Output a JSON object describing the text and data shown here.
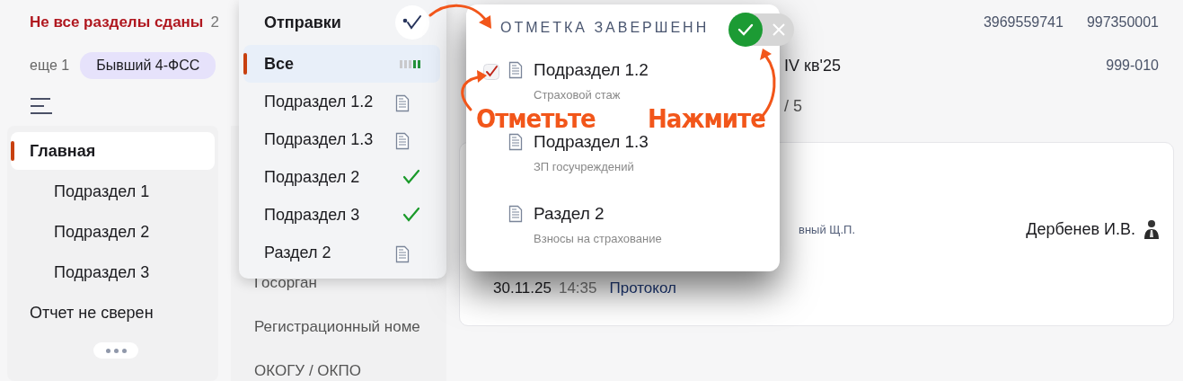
{
  "header": {
    "status": "Не все разделы сданы",
    "status_count": "2",
    "inn": "3969559741",
    "kpp": "997350001",
    "more": "еще 1",
    "tag": "Бывший 4-ФСС",
    "period": "IV кв'25",
    "code": "999-010",
    "progress": "/ 5"
  },
  "sidebar": {
    "items": [
      {
        "label": "Главная",
        "selected": true,
        "children": [
          {
            "label": "Подраздел 1",
            "selected": false
          },
          {
            "label": "Подраздел 2",
            "selected": false
          },
          {
            "label": "Подраздел 3",
            "selected": false
          }
        ]
      },
      {
        "label": "Отчет не сверен",
        "selected": false
      }
    ]
  },
  "details": {
    "labels": [
      "Госорган",
      "Регистрационный номе",
      "ОКОГУ / ОКПО"
    ]
  },
  "card": {
    "signer_role": "вный Щ.П.",
    "signer": "Дербенев И.В.",
    "date": "30.11.25",
    "time": "14:35",
    "link": "Протокол"
  },
  "submissions_menu": {
    "title": "Отправки",
    "items": [
      {
        "label": "Все",
        "selected": true,
        "kind": "progress"
      },
      {
        "label": "Подраздел 1.2",
        "selected": false,
        "kind": "document"
      },
      {
        "label": "Подраздел 1.3",
        "selected": false,
        "kind": "document"
      },
      {
        "label": "Подраздел 2",
        "selected": false,
        "kind": "done"
      },
      {
        "label": "Подраздел 3",
        "selected": false,
        "kind": "done"
      },
      {
        "label": "Раздел 2",
        "selected": false,
        "kind": "document"
      }
    ]
  },
  "completion_popup": {
    "title": "ОТМЕТКА ЗАВЕРШЕНН",
    "items": [
      {
        "title": "Подраздел 1.2",
        "subtitle": "Страховой стаж",
        "checked": true
      },
      {
        "title": "Подраздел 1.3",
        "subtitle": "ЗП госучреждений",
        "checked": false
      },
      {
        "title": "Раздел 2",
        "subtitle": "Взносы на страхование",
        "checked": false
      }
    ]
  },
  "annotations": [
    {
      "text": "Отметьте"
    },
    {
      "text": "Нажмите"
    }
  ]
}
